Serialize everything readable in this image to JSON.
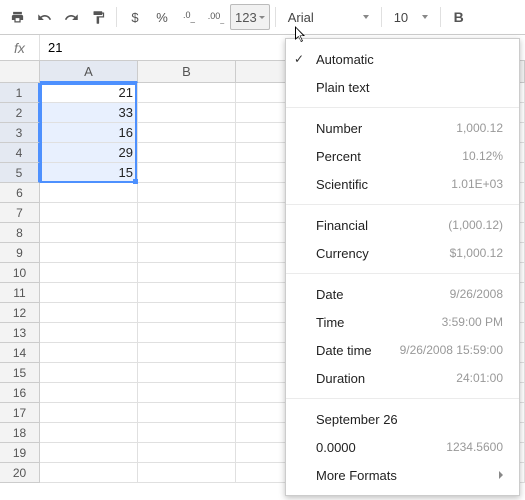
{
  "toolbar": {
    "dollar": "$",
    "percent": "%",
    "dec_decrease": ".0",
    "dec_increase": ".00",
    "format_btn": "123",
    "font": "Arial",
    "font_size": "10",
    "bold": "B"
  },
  "formula": {
    "fx": "fx",
    "value": "21"
  },
  "columns": [
    "A",
    "B"
  ],
  "rows": [
    {
      "n": 1,
      "a": "21"
    },
    {
      "n": 2,
      "a": "33"
    },
    {
      "n": 3,
      "a": "16"
    },
    {
      "n": 4,
      "a": "29"
    },
    {
      "n": 5,
      "a": "15"
    },
    {
      "n": 6,
      "a": ""
    },
    {
      "n": 7,
      "a": ""
    },
    {
      "n": 8,
      "a": ""
    },
    {
      "n": 9,
      "a": ""
    },
    {
      "n": 10,
      "a": ""
    },
    {
      "n": 11,
      "a": ""
    },
    {
      "n": 12,
      "a": ""
    },
    {
      "n": 13,
      "a": ""
    },
    {
      "n": 14,
      "a": ""
    },
    {
      "n": 15,
      "a": ""
    },
    {
      "n": 16,
      "a": ""
    },
    {
      "n": 17,
      "a": ""
    },
    {
      "n": 18,
      "a": ""
    },
    {
      "n": 19,
      "a": ""
    },
    {
      "n": 20,
      "a": ""
    }
  ],
  "menu": {
    "automatic": "Automatic",
    "plain": "Plain text",
    "number": {
      "label": "Number",
      "ex": "1,000.12"
    },
    "percent": {
      "label": "Percent",
      "ex": "10.12%"
    },
    "scientific": {
      "label": "Scientific",
      "ex": "1.01E+03"
    },
    "financial": {
      "label": "Financial",
      "ex": "(1,000.12)"
    },
    "currency": {
      "label": "Currency",
      "ex": "$1,000.12"
    },
    "date": {
      "label": "Date",
      "ex": "9/26/2008"
    },
    "time": {
      "label": "Time",
      "ex": "3:59:00 PM"
    },
    "datetime": {
      "label": "Date time",
      "ex": "9/26/2008 15:59:00"
    },
    "duration": {
      "label": "Duration",
      "ex": "24:01:00"
    },
    "custom1": {
      "label": "September 26",
      "ex": ""
    },
    "custom2": {
      "label": "0.0000",
      "ex": "1234.5600"
    },
    "more": "More Formats"
  }
}
